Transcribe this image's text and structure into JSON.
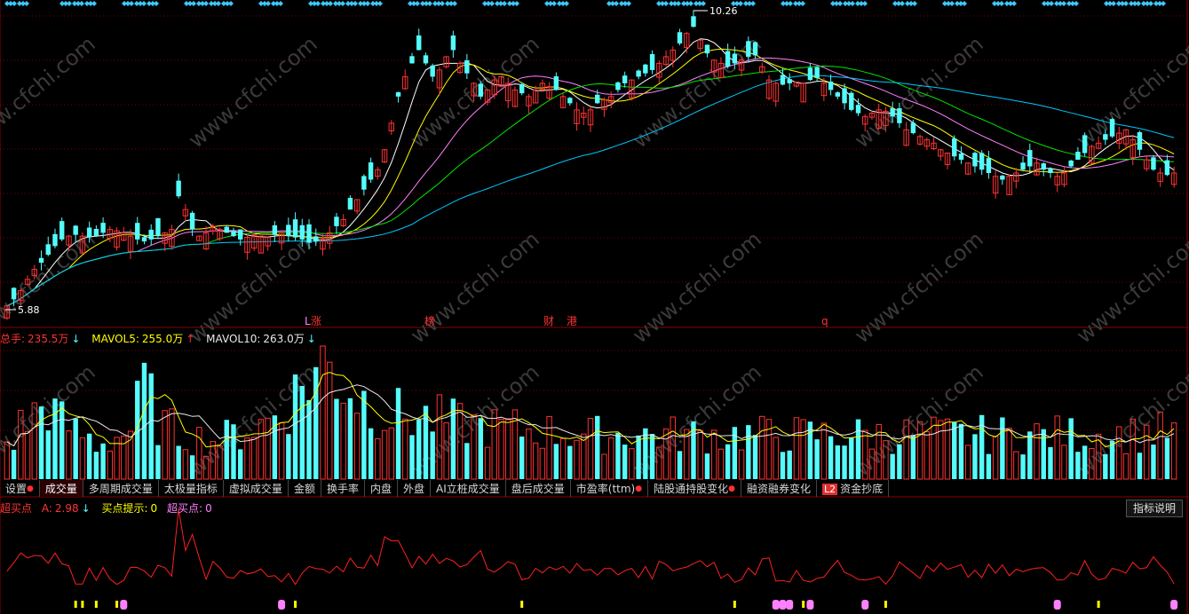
{
  "colors": {
    "up": "#ff3232",
    "down": "#54fcfc",
    "ma5": "#ffffff",
    "ma10": "#ffff00",
    "ma20": "#ff80ff",
    "ma30": "#00e600",
    "ma60": "#00c8ff",
    "grid": "#7a0000",
    "indicator": "#ff2020",
    "buy_hint": "#ffff00",
    "super_buy": "#ff80ff"
  },
  "price_panel": {
    "high_label": "10.26",
    "low_label": "5.88",
    "event_markers": [
      {
        "text": "L",
        "color": "#ff80ff"
      },
      {
        "text": "涨",
        "color": "#ff3232"
      },
      {
        "text": "榜",
        "color": "#ff3232"
      },
      {
        "text": "财",
        "color": "#ff3232"
      },
      {
        "text": "港",
        "color": "#ff3232"
      },
      {
        "text": "q",
        "color": "#ff3232"
      }
    ]
  },
  "volume_panel": {
    "total_label": "总手:",
    "total_value": "235.5万",
    "total_arrow": "↓",
    "mavol5_label": "MAVOL5:",
    "mavol5_value": "255.0万",
    "mavol5_arrow": "↑",
    "mavol10_label": "MAVOL10:",
    "mavol10_value": "263.0万",
    "mavol10_arrow": "↓"
  },
  "tabs": [
    {
      "label": "设置",
      "dot": true
    },
    {
      "label": "成交量",
      "active": true
    },
    {
      "label": "多周期成交量"
    },
    {
      "label": "太极量指标"
    },
    {
      "label": "虚拟成交量"
    },
    {
      "label": "金额"
    },
    {
      "label": "换手率"
    },
    {
      "label": "内盘"
    },
    {
      "label": "外盘"
    },
    {
      "label": "AI立桩成交量"
    },
    {
      "label": "盘后成交量"
    },
    {
      "label": "市盈率(ttm)",
      "dot": true
    },
    {
      "label": "陆股通持股变化",
      "dot": true
    },
    {
      "label": "融资融券变化"
    },
    {
      "label": "资金抄底",
      "badge": "L2"
    }
  ],
  "indicator_panel": {
    "name": "超买点",
    "a_label": "A:",
    "a_value": "2.98",
    "a_arrow": "↓",
    "hint_label": "买点提示:",
    "hint_value": "0",
    "super_label": "超买点:",
    "super_value": "0",
    "help_button": "指标说明"
  },
  "watermark": "www.cfchi.com",
  "chart_data": {
    "type": "candlestick",
    "price_range": [
      5.88,
      10.26
    ],
    "series": [
      {
        "name": "K线",
        "note": "daily candles, approximate"
      },
      {
        "name": "MA5"
      },
      {
        "name": "MA10"
      },
      {
        "name": "MA20"
      },
      {
        "name": "MA30"
      },
      {
        "name": "MA60"
      }
    ],
    "closes": [
      5.95,
      6.05,
      6.18,
      6.35,
      6.5,
      6.6,
      6.72,
      6.85,
      6.95,
      7.0,
      7.02,
      7.0,
      6.98,
      7.0,
      7.05,
      7.1,
      7.08,
      7.05,
      7.0,
      6.95,
      6.92,
      6.95,
      7.0,
      7.05,
      7.1,
      7.6,
      7.4,
      7.1,
      7.0,
      7.05,
      7.15,
      7.1,
      7.05,
      7.0,
      6.95,
      6.98,
      7.02,
      7.0,
      6.98,
      7.02,
      7.05,
      7.0,
      6.98,
      6.95,
      6.9,
      6.92,
      6.95,
      7.05,
      7.15,
      7.25,
      7.4,
      7.55,
      7.7,
      7.85,
      8.0,
      8.3,
      8.7,
      9.1,
      9.4,
      9.6,
      9.8,
      9.6,
      9.4,
      9.5,
      9.7,
      9.8,
      9.6,
      9.45,
      9.3,
      9.1,
      9.2,
      9.35,
      9.4,
      9.3,
      9.2,
      9.15,
      9.1,
      9.2,
      9.3,
      9.25,
      9.2,
      9.1,
      9.0,
      8.9,
      8.85,
      8.9,
      9.0,
      9.05,
      9.1,
      9.2,
      9.3,
      9.35,
      9.4,
      9.45,
      9.5,
      9.6,
      9.7,
      9.8,
      9.9,
      10.05,
      10.15,
      9.95,
      9.75,
      9.65,
      9.6,
      9.55,
      9.6,
      9.65,
      9.7,
      9.72,
      9.55,
      9.35,
      9.3,
      9.28,
      9.3,
      9.32,
      9.3,
      9.35,
      9.38,
      9.3,
      9.2,
      9.1,
      9.0,
      8.9,
      8.85,
      8.8,
      8.85,
      8.9,
      8.88,
      8.8,
      8.7,
      8.6,
      8.55,
      8.5,
      8.45,
      8.4,
      8.3,
      8.25,
      8.2,
      8.15,
      8.1,
      8.05,
      8.0,
      7.95,
      7.9,
      7.85,
      7.9,
      7.95,
      8.0,
      8.05,
      8.1,
      8.0,
      7.95,
      7.9,
      7.95,
      8.05,
      8.15,
      8.25,
      8.35,
      8.4,
      8.45,
      8.5,
      8.55,
      8.6,
      8.45,
      8.3,
      8.15,
      8.0,
      7.95,
      7.92,
      7.95
    ],
    "volume": [
      30,
      35,
      45,
      50,
      55,
      60,
      65,
      55,
      48,
      45,
      40,
      38,
      35,
      30,
      32,
      34,
      36,
      40,
      42,
      60,
      82,
      65,
      50,
      45,
      42,
      40,
      38,
      36,
      35,
      34,
      33,
      35,
      36,
      38,
      40,
      42,
      44,
      46,
      50,
      55,
      60,
      65,
      72,
      80,
      88,
      92,
      98,
      96,
      90,
      84,
      78,
      72,
      68,
      64,
      60,
      56,
      55,
      55,
      54,
      53,
      52,
      52,
      51,
      50,
      49,
      48,
      47,
      47,
      46,
      45,
      45,
      44,
      44,
      43,
      43,
      42,
      42,
      41,
      41,
      40,
      40,
      40,
      39,
      39,
      38,
      38,
      38,
      38,
      38,
      38,
      38,
      38,
      38,
      38,
      38,
      38,
      38,
      38,
      38,
      38,
      38,
      38,
      38,
      38,
      38,
      38,
      38,
      38,
      38,
      38,
      38,
      38,
      38,
      38,
      38,
      38,
      38,
      38,
      38,
      38,
      38,
      38,
      38,
      38,
      38,
      38,
      38,
      38,
      38,
      38,
      38,
      38,
      38,
      38,
      38,
      38,
      38,
      38,
      38,
      38,
      38,
      38,
      38,
      38,
      38,
      38,
      38,
      38,
      38,
      38,
      38,
      38,
      38,
      38,
      38,
      38,
      38,
      38,
      38,
      38,
      38,
      38,
      38,
      38,
      38,
      38
    ]
  }
}
